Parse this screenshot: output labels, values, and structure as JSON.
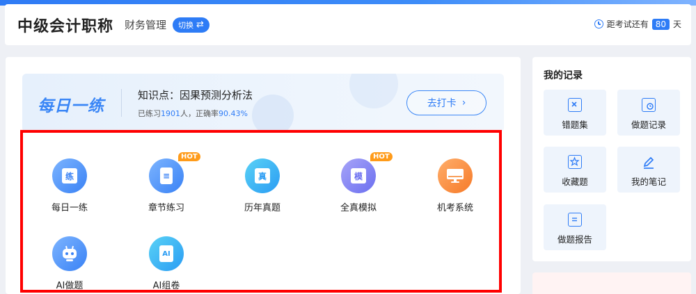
{
  "header": {
    "title": "中级会计职称",
    "subject": "财务管理",
    "switch_label": "切换",
    "switch_arrows": "⇄",
    "countdown_prefix": "距考试还有",
    "countdown_days": "80",
    "countdown_suffix": "天"
  },
  "banner": {
    "logo_text": "每日一练",
    "knowledge_point": "知识点：因果预测分析法",
    "stats_prefix": "已练习",
    "stats_count": "1901",
    "stats_middle": "人，正确率",
    "stats_rate": "90.43%",
    "checkin_label": "去打卡",
    "checkin_chevron": "›"
  },
  "tiles": [
    {
      "label": "每日一练",
      "glyph": "练",
      "icon": "practice-icon"
    },
    {
      "label": "章节练习",
      "glyph": "≡",
      "icon": "document-icon",
      "badge": "HOT"
    },
    {
      "label": "历年真题",
      "glyph": "真",
      "icon": "past-exam-icon"
    },
    {
      "label": "全真模拟",
      "glyph": "模",
      "icon": "mock-exam-icon",
      "badge": "HOT"
    },
    {
      "label": "机考系统",
      "glyph": "",
      "icon": "computer-icon"
    },
    {
      "label": "AI做题",
      "glyph": "",
      "icon": "robot-icon"
    },
    {
      "label": "AI组卷",
      "glyph": "AI",
      "icon": "ai-paper-icon"
    }
  ],
  "sidebar": {
    "title": "我的记录",
    "items": [
      {
        "label": "错题集",
        "icon": "error-book-icon"
      },
      {
        "label": "做题记录",
        "icon": "history-icon"
      },
      {
        "label": "收藏题",
        "icon": "star-icon"
      },
      {
        "label": "我的笔记",
        "icon": "pen-icon"
      },
      {
        "label": "做题报告",
        "icon": "report-icon"
      }
    ]
  },
  "colors": {
    "accent": "#2e7cf6",
    "hot_badge": "#ff9b1a",
    "highlight_box": "#ff0000"
  }
}
